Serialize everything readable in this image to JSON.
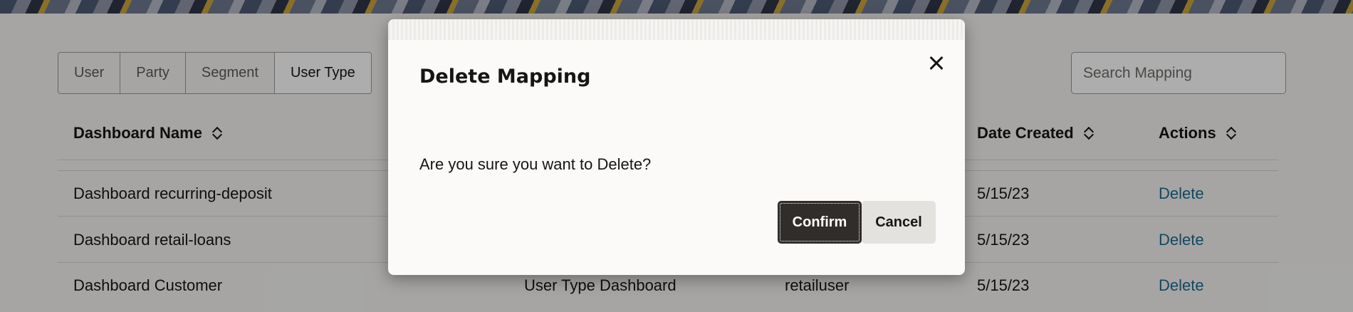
{
  "filter_tabs": [
    {
      "label": "User",
      "selected": false
    },
    {
      "label": "Party",
      "selected": false
    },
    {
      "label": "Segment",
      "selected": false
    },
    {
      "label": "User Type",
      "selected": true
    }
  ],
  "search": {
    "placeholder": "Search Mapping",
    "value": ""
  },
  "table": {
    "headers": {
      "dashboard_name": "Dashboard Name",
      "date_created": "Date Created",
      "actions": "Actions"
    },
    "rows": [
      {
        "dashboard_name": "Dashboard recurring-deposit",
        "date_created": "5/15/23",
        "action": "Delete"
      },
      {
        "dashboard_name": "Dashboard retail-loans",
        "date_created": "5/15/23",
        "action": "Delete"
      },
      {
        "dashboard_name": "Dashboard Customer",
        "mapping_type": "User Type Dashboard",
        "user": "retailuser",
        "date_created": "5/15/23",
        "action": "Delete"
      }
    ]
  },
  "dialog": {
    "title": "Delete Mapping",
    "message": "Are you sure you want to Delete?",
    "confirm_label": "Confirm",
    "cancel_label": "Cancel"
  },
  "colors": {
    "link": "#1b6a8f",
    "primary_button": "#312d2a",
    "secondary_button": "#e4e2df"
  }
}
